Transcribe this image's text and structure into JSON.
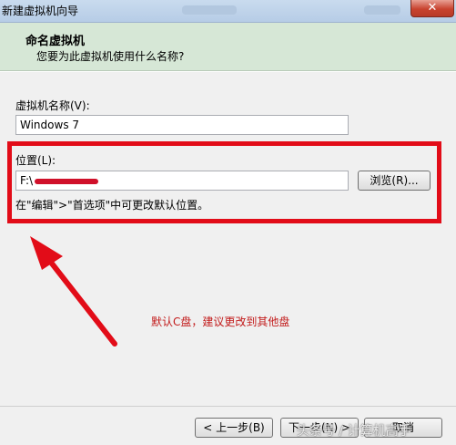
{
  "window": {
    "title": "新建虚拟机向导",
    "close_label": "✕"
  },
  "header": {
    "title": "命名虚拟机",
    "subtitle": "您要为此虚拟机使用什么名称?"
  },
  "vm_name": {
    "label": "虚拟机名称(V):",
    "value": "Windows 7"
  },
  "location": {
    "label": "位置(L):",
    "value": "F:\\",
    "browse_label": "浏览(R)...",
    "hint": "在\"编辑\">\"首选项\"中可更改默认位置。"
  },
  "annotation": {
    "text": "默认C盘，建议更改到其他盘",
    "color": "#c21b1b"
  },
  "footer": {
    "back_label": "< 上一步(B)",
    "next_label": "下一步(N) >",
    "cancel_label": "取消"
  },
  "watermark": "头条号 / 计算机高手",
  "colors": {
    "highlight": "#e20c18",
    "header_bg": "#d6e7d6"
  }
}
